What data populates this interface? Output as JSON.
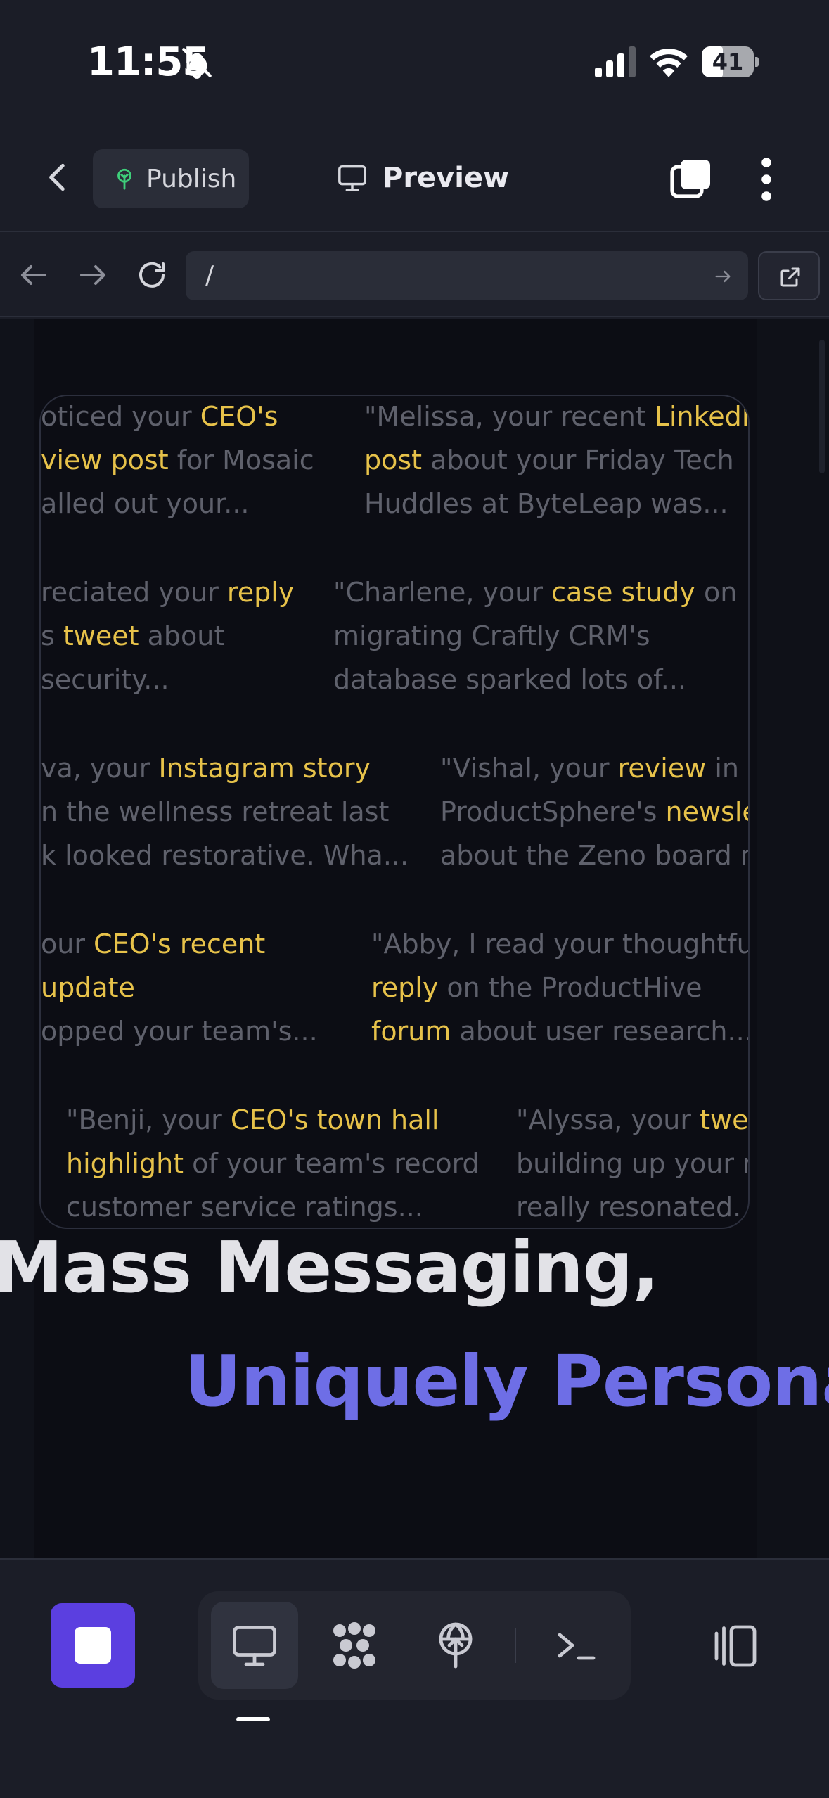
{
  "status_bar": {
    "time": "11:55",
    "battery_level": "41",
    "battery_fraction": 0.41,
    "icons": [
      "bell-slash-icon",
      "cellular-signal-icon",
      "wifi-icon",
      "battery-icon"
    ]
  },
  "toolbar": {
    "back_icon": "chevron-left-icon",
    "publish_label": "Publish",
    "publish_icon": "publish-tree-icon",
    "preview_label": "Preview",
    "preview_icon": "monitor-icon",
    "tabs_icon": "tabs-icon",
    "more_icon": "vertical-dots-icon"
  },
  "url_bar": {
    "path": "/",
    "icons": [
      "arrow-left-icon",
      "arrow-right-icon",
      "reload-icon",
      "go-arrow-icon",
      "open-external-icon"
    ]
  },
  "page": {
    "quotes": [
      [
        {
          "t": "oticed your "
        },
        {
          "t": "CEO's",
          "h": true
        }
      ],
      [
        {
          "t": "view post",
          "h": true
        },
        {
          "t": " for Mosaic"
        }
      ],
      [
        {
          "t": "alled out your..."
        }
      ],
      [
        {
          "t": "\"Melissa, your recent "
        },
        {
          "t": "LinkedIn",
          "h": true
        }
      ],
      [
        {
          "t": "post",
          "h": true
        },
        {
          "t": " about your Friday Tech"
        }
      ],
      [
        {
          "t": "Huddles at ByteLeap was..."
        }
      ],
      [
        {
          "t": "reciated your "
        },
        {
          "t": "reply",
          "h": true
        }
      ],
      [
        {
          "t": "s "
        },
        {
          "t": "tweet",
          "h": true
        },
        {
          "t": " about"
        }
      ],
      [
        {
          "t": "security..."
        }
      ],
      [
        {
          "t": "\"Charlene, your "
        },
        {
          "t": "case study",
          "h": true
        },
        {
          "t": " on"
        }
      ],
      [
        {
          "t": "migrating Craftly CRM's"
        }
      ],
      [
        {
          "t": "database sparked lots of..."
        }
      ],
      [
        {
          "t": "va, your "
        },
        {
          "t": "Instagram story",
          "h": true
        }
      ],
      [
        {
          "t": "n the wellness retreat last"
        }
      ],
      [
        {
          "t": "k looked restorative. Wha..."
        }
      ],
      [
        {
          "t": "\"Vishal, your "
        },
        {
          "t": "review",
          "h": true
        },
        {
          "t": " in"
        }
      ],
      [
        {
          "t": "ProductSphere's "
        },
        {
          "t": "newsle",
          "h": true
        }
      ],
      [
        {
          "t": "about the Zeno board m"
        }
      ],
      [
        {
          "t": "our "
        },
        {
          "t": "CEO's recent",
          "h": true
        }
      ],
      [
        {
          "t": "update",
          "h": true
        }
      ],
      [
        {
          "t": "opped your team's..."
        }
      ],
      [
        {
          "t": "\"Abby, I read your thoughtful"
        }
      ],
      [
        {
          "t": "reply",
          "h": true
        },
        {
          "t": " on the ProductHive"
        }
      ],
      [
        {
          "t": "forum",
          "h": true
        },
        {
          "t": " about user research..."
        }
      ],
      [
        {
          "t": "\"Benji, your "
        },
        {
          "t": "CEO's town hall",
          "h": true
        }
      ],
      [
        {
          "t": "highlight",
          "h": true
        },
        {
          "t": " of your team's record"
        }
      ],
      [
        {
          "t": "customer service ratings..."
        }
      ],
      [
        {
          "t": "\"Alyssa, your "
        },
        {
          "t": "twee",
          "h": true
        }
      ],
      [
        {
          "t": "building up your m"
        }
      ],
      [
        {
          "t": "really resonated. V"
        }
      ]
    ],
    "headline_line1": "Mass Messaging,",
    "headline_line2": "Uniquely Personal."
  },
  "bottom_bar": {
    "stop_icon": "stop-square-icon",
    "modes": [
      "desktop-preview-icon",
      "canvas-blob-icon",
      "deploy-globe-icon",
      "terminal-icon"
    ],
    "active_mode": "desktop-preview-icon",
    "panel_icon": "side-panel-icon"
  },
  "colors": {
    "background": "#1b1d27",
    "accent": "#5b3fe0",
    "highlight": "#e7c24a",
    "headline_blue": "#6e6ee6"
  }
}
